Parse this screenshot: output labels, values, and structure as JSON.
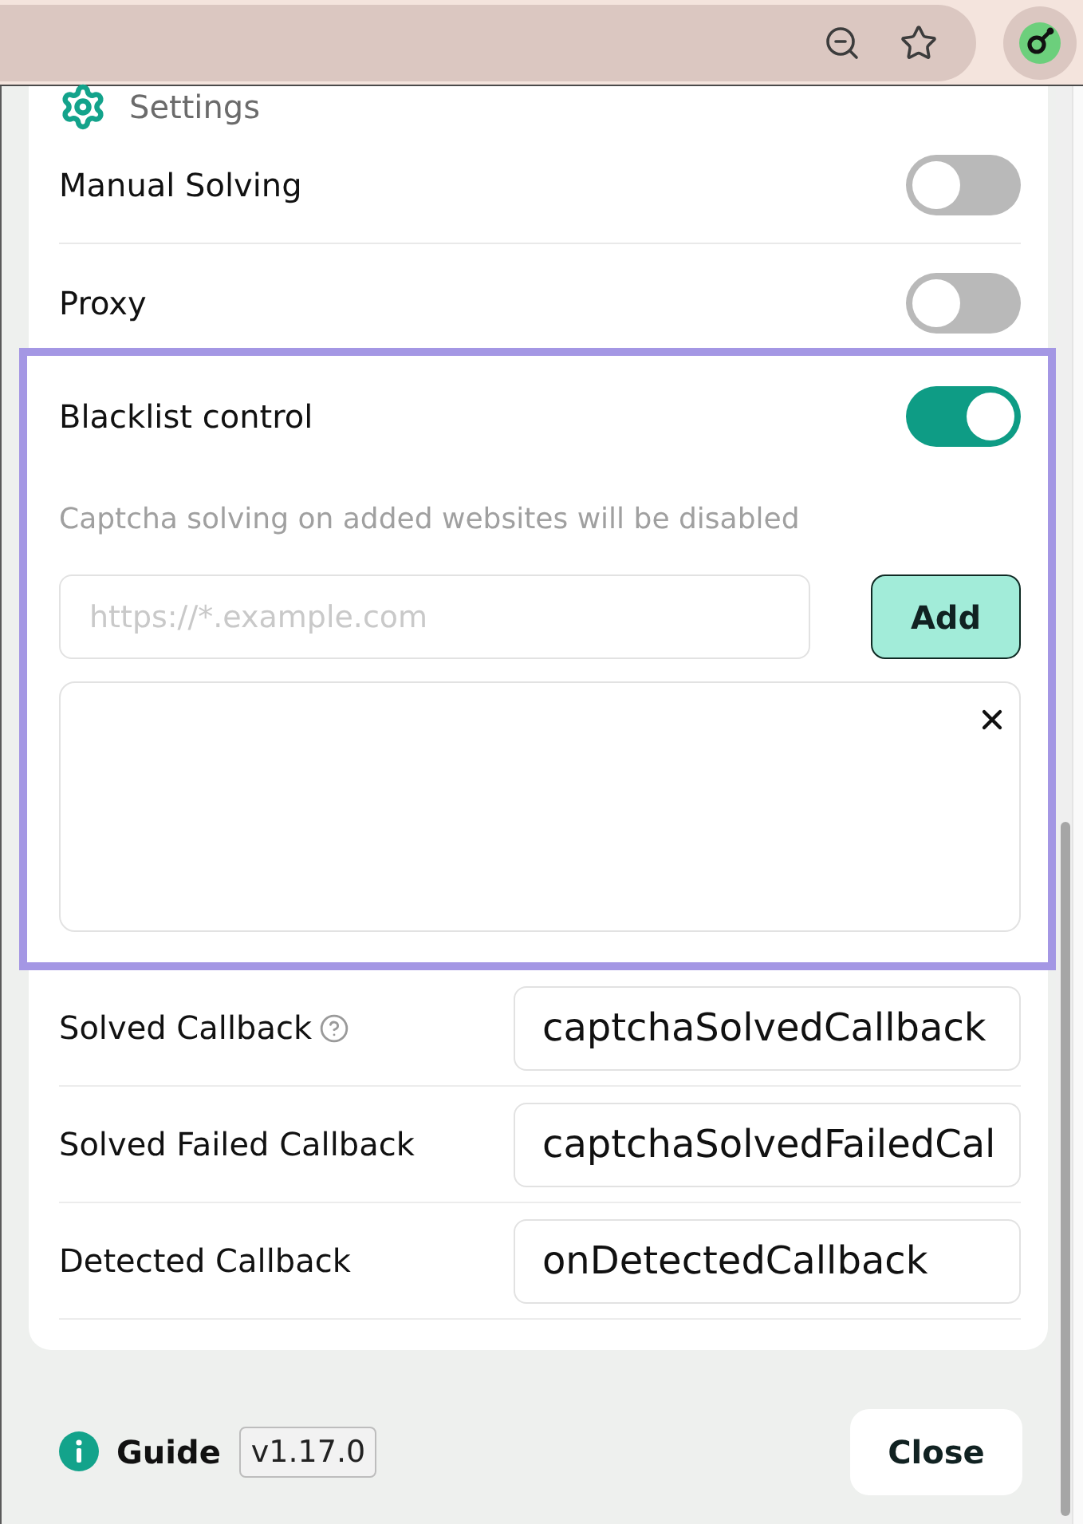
{
  "settings": {
    "title": "Settings"
  },
  "toggles": [
    {
      "label": "Manual Solving",
      "on": false
    },
    {
      "label": "Proxy",
      "on": false
    }
  ],
  "blacklist": {
    "label": "Blacklist control",
    "on": true,
    "highlighted": true,
    "description": "Captcha solving on added websites will be disabled",
    "url_field": {
      "placeholder": "https://*.example.com"
    },
    "add_button": "Add"
  },
  "callbacks": [
    {
      "label": "Solved Callback",
      "help": true,
      "value": "captchaSolvedCallback"
    },
    {
      "label": "Solved Failed Callback",
      "help": false,
      "value": "captchaSolvedFailedCal"
    },
    {
      "label": "Detected Callback",
      "help": false,
      "value": "onDetectedCallback"
    }
  ],
  "footer": {
    "guide": "Guide",
    "version": "v1.17.0",
    "close_button": "Close"
  }
}
